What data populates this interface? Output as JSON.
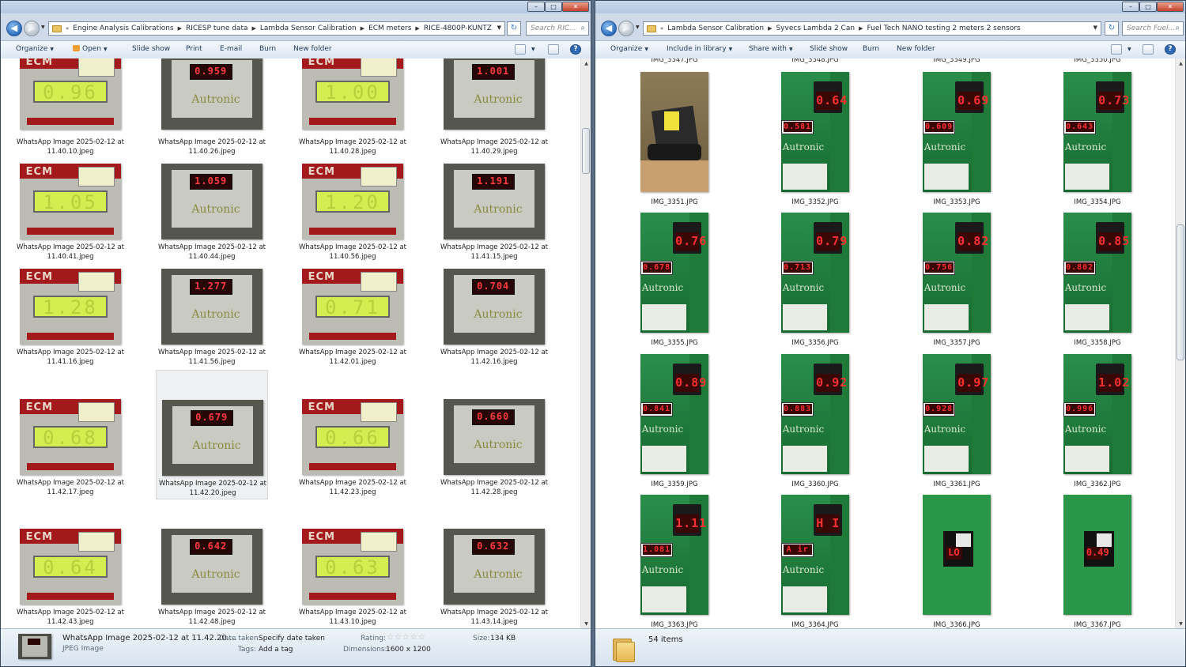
{
  "left": {
    "breadcrumb": [
      "Engine Analysis Calibrations",
      "RICESP tune data",
      "Lambda Sensor Calibration",
      "ECM meters",
      "RICE-4800P-KUNTZ"
    ],
    "search_placeholder": "Search RIC...",
    "toolbar": {
      "organize": "Organize",
      "open": "Open",
      "slideshow": "Slide show",
      "print": "Print",
      "email": "E-mail",
      "burn": "Burn",
      "new_folder": "New folder"
    },
    "items": [
      {
        "label": "WhatsApp Image 2025-02-12 at\n11.40.10.jpeg",
        "kind": "ecm",
        "reading": "0.96"
      },
      {
        "label": "WhatsApp Image 2025-02-12 at\n11.40.26.jpeg",
        "kind": "aut",
        "reading": "0.959"
      },
      {
        "label": "WhatsApp Image 2025-02-12 at\n11.40.28.jpeg",
        "kind": "ecm",
        "reading": "1.00"
      },
      {
        "label": "WhatsApp Image 2025-02-12 at\n11.40.29.jpeg",
        "kind": "aut",
        "reading": "1.001"
      },
      {
        "label": "WhatsApp Image 2025-02-12 at\n11.40.41.jpeg",
        "kind": "ecm",
        "reading": "1.05"
      },
      {
        "label": "WhatsApp Image 2025-02-12 at\n11.40.44.jpeg",
        "kind": "aut",
        "reading": "1.059"
      },
      {
        "label": "WhatsApp Image 2025-02-12 at\n11.40.56.jpeg",
        "kind": "ecm",
        "reading": "1.20"
      },
      {
        "label": "WhatsApp Image 2025-02-12 at\n11.41.15.jpeg",
        "kind": "aut",
        "reading": "1.191"
      },
      {
        "label": "WhatsApp Image 2025-02-12 at\n11.41.16.jpeg",
        "kind": "ecm",
        "reading": "1.28"
      },
      {
        "label": "WhatsApp Image 2025-02-12 at\n11.41.56.jpeg",
        "kind": "aut",
        "reading": "1.277"
      },
      {
        "label": "WhatsApp Image 2025-02-12 at\n11.42.01.jpeg",
        "kind": "ecm",
        "reading": "0.71"
      },
      {
        "label": "WhatsApp Image 2025-02-12 at\n11.42.16.jpeg",
        "kind": "aut",
        "reading": "0.704"
      },
      {
        "label": "WhatsApp Image 2025-02-12 at\n11.42.17.jpeg",
        "kind": "ecm",
        "reading": "0.68"
      },
      {
        "label": "WhatsApp Image 2025-02-12 at\n11.42.20.jpeg",
        "kind": "aut",
        "reading": "0.679",
        "selected": true
      },
      {
        "label": "WhatsApp Image 2025-02-12 at\n11.42.23.jpeg",
        "kind": "ecm",
        "reading": "0.66"
      },
      {
        "label": "WhatsApp Image 2025-02-12 at\n11.42.28.jpeg",
        "kind": "aut",
        "reading": "0.660"
      },
      {
        "label": "WhatsApp Image 2025-02-12 at\n11.42.43.jpeg",
        "kind": "ecm",
        "reading": "0.64"
      },
      {
        "label": "WhatsApp Image 2025-02-12 at\n11.42.48.jpeg",
        "kind": "aut",
        "reading": "0.642"
      },
      {
        "label": "WhatsApp Image 2025-02-12 at\n11.43.10.jpeg",
        "kind": "ecm",
        "reading": "0.63"
      },
      {
        "label": "WhatsApp Image 2025-02-12 at\n11.43.14.jpeg",
        "kind": "aut",
        "reading": "0.632"
      }
    ],
    "details": {
      "name": "WhatsApp Image 2025-02-12 at 11.42.20....",
      "type": "JPEG Image",
      "date_label": "Date taken:",
      "date_value": "Specify date taken",
      "tags_label": "Tags:",
      "tags_value": "Add a tag",
      "rating_label": "Rating:",
      "rating_stars": "☆☆☆☆☆",
      "dimensions_label": "Dimensions:",
      "dimensions_value": "1600 x 1200",
      "size_label": "Size:",
      "size_value": "134 KB"
    }
  },
  "right": {
    "breadcrumb": [
      "Lambda Sensor Calibration",
      "Syvecs Lambda 2 Can",
      "Fuel Tech NANO testing 2 meters 2 sensors"
    ],
    "search_placeholder": "Search Fuel...",
    "toolbar": {
      "organize": "Organize",
      "include": "Include in library",
      "share": "Share with",
      "slideshow": "Slide show",
      "burn": "Burn",
      "new_folder": "New folder"
    },
    "top_partial_labels": [
      "IMG_3347.JPG",
      "IMG_3348.JPG",
      "IMG_3349.JPG",
      "IMG_3350.JPG"
    ],
    "items": [
      {
        "label": "IMG_3351.JPG",
        "kind": "pic1"
      },
      {
        "label": "IMG_3352.JPG",
        "kind": "ft",
        "main": "0.64",
        "sub": "0.581"
      },
      {
        "label": "IMG_3353.JPG",
        "kind": "ft",
        "main": "0.69",
        "sub": "0.609"
      },
      {
        "label": "IMG_3354.JPG",
        "kind": "ft",
        "main": "0.73",
        "sub": "0.643"
      },
      {
        "label": "IMG_3355.JPG",
        "kind": "ft",
        "main": "0.76",
        "sub": "0.678"
      },
      {
        "label": "IMG_3356.JPG",
        "kind": "ft",
        "main": "0.79",
        "sub": "0.713"
      },
      {
        "label": "IMG_3357.JPG",
        "kind": "ft",
        "main": "0.82",
        "sub": "0.756"
      },
      {
        "label": "IMG_3358.JPG",
        "kind": "ft",
        "main": "0.85",
        "sub": "0.802"
      },
      {
        "label": "IMG_3359.JPG",
        "kind": "ft",
        "main": "0.89",
        "sub": "0.841"
      },
      {
        "label": "IMG_3360.JPG",
        "kind": "ft",
        "main": "0.92",
        "sub": "0.883"
      },
      {
        "label": "IMG_3361.JPG",
        "kind": "ft",
        "main": "0.97",
        "sub": "0.928"
      },
      {
        "label": "IMG_3362.JPG",
        "kind": "ft",
        "main": "1.02",
        "sub": "0.996"
      },
      {
        "label": "IMG_3363.JPG",
        "kind": "ft",
        "main": "1.11",
        "sub": "1.081"
      },
      {
        "label": "IMG_3364.JPG",
        "kind": "ft",
        "main": "H I",
        "sub": "A ir"
      },
      {
        "label": "IMG_3366.JPG",
        "kind": "green2",
        "main": "LO"
      },
      {
        "label": "IMG_3367.JPG",
        "kind": "green2",
        "main": "0.49"
      }
    ],
    "status_count": "54 items"
  }
}
